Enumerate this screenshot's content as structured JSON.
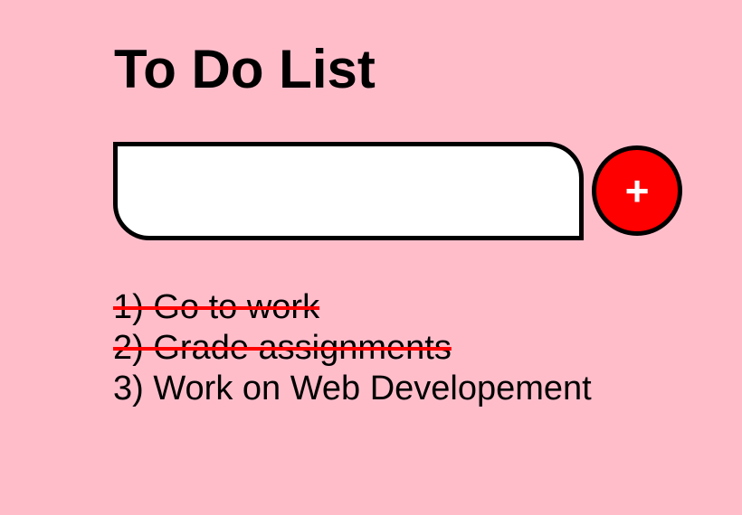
{
  "page": {
    "title": "To Do List",
    "background_color": "#ffbdca"
  },
  "input": {
    "value": "",
    "placeholder": ""
  },
  "add_button": {
    "label": "+",
    "color": "#ff0000",
    "icon": "plus-icon"
  },
  "tasks": [
    {
      "label": "1) Go to work",
      "completed": true
    },
    {
      "label": "2) Grade assignments",
      "completed": true
    },
    {
      "label": "3) Work on Web Developement",
      "completed": false
    }
  ],
  "strike_color": "#ff0000"
}
